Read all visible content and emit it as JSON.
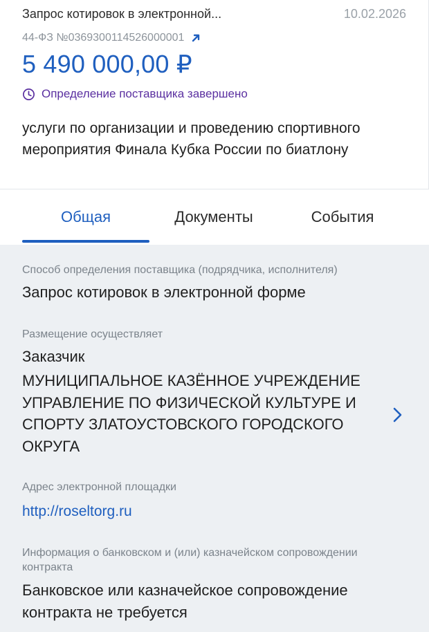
{
  "card": {
    "title": "Запрос котировок в электронной...",
    "date": "10.02.2026",
    "number": "44-ФЗ №0369300114526000001",
    "price": "5 490 000,00 ₽",
    "status": "Определение поставщика завершено",
    "description": "услуги по организации и проведению спортивного мероприятия Финала Кубка России по биатлону"
  },
  "tabs": [
    "Общая",
    "Документы",
    "События"
  ],
  "fields": {
    "method_label": "Способ определения поставщика (подрядчика, исполнителя)",
    "method_value": "Запрос котировок в электронной форме",
    "placement_label": "Размещение осуществляет",
    "placement_role": "Заказчик",
    "placement_org": "МУНИЦИПАЛЬНОЕ КАЗЁННОЕ УЧРЕЖДЕНИЕ УПРАВЛЕНИЕ ПО ФИЗИЧЕСКОЙ КУЛЬТУРЕ И СПОРТУ ЗЛАТОУСТОВСКОГО ГОРОДСКОГО ОКРУГА",
    "address_label": "Адрес электронной площадки",
    "address_value": "http://roseltorg.ru",
    "bank_label": "Информация о банковском и (или) казначейском сопровождении контракта",
    "bank_value": "Банковское или казначейское сопровождение контракта не требуется"
  },
  "icons": {
    "number_link": "arrow-up-right-icon",
    "status": "clock-icon",
    "org_more": "chevron-right-icon"
  },
  "colors": {
    "accent": "#1f5fbf",
    "status": "#5a2fa0",
    "muted": "#7b838b",
    "panel_bg": "#edf0f3"
  }
}
